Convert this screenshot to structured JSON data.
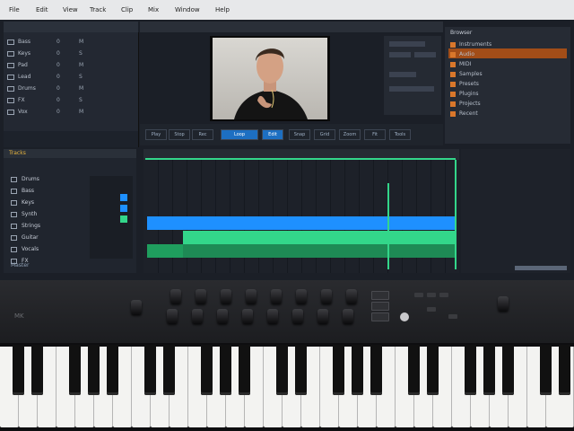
{
  "menu": [
    "File",
    "Edit",
    "View",
    "Track",
    "Clip",
    "Mix",
    "Window",
    "Help"
  ],
  "left_panel": {
    "rows": [
      {
        "label": "Bass",
        "v1": "0",
        "v2": "M"
      },
      {
        "label": "Keys",
        "v1": "0",
        "v2": "S"
      },
      {
        "label": "Pad",
        "v1": "0",
        "v2": "M"
      },
      {
        "label": "Lead",
        "v1": "0",
        "v2": "S"
      },
      {
        "label": "Drums",
        "v1": "0",
        "v2": "M"
      },
      {
        "label": "FX",
        "v1": "0",
        "v2": "S"
      },
      {
        "label": "Vox",
        "v1": "0",
        "v2": "M"
      }
    ]
  },
  "right_panel": {
    "title": "Browser",
    "items": [
      "Instruments",
      "Audio",
      "MIDI",
      "Samples",
      "Presets",
      "Plugins",
      "Projects",
      "Recent"
    ]
  },
  "toolbar": {
    "buttons": [
      "Play",
      "Stop",
      "Rec",
      "Loop",
      "Edit",
      "Snap",
      "Grid",
      "Zoom",
      "Fit",
      "Tools"
    ]
  },
  "tracks": {
    "header": "Tracks",
    "names": [
      "Drums",
      "Bass",
      "Keys",
      "Synth",
      "Strings",
      "Guitar",
      "Vocals",
      "FX"
    ],
    "footer": "Master"
  },
  "arrange": {
    "clip_colors": {
      "blue": "#1e90ff",
      "green": "#33d68a",
      "dark_green": "#1e8a55"
    }
  },
  "keyboard": {
    "brand": "MK"
  }
}
